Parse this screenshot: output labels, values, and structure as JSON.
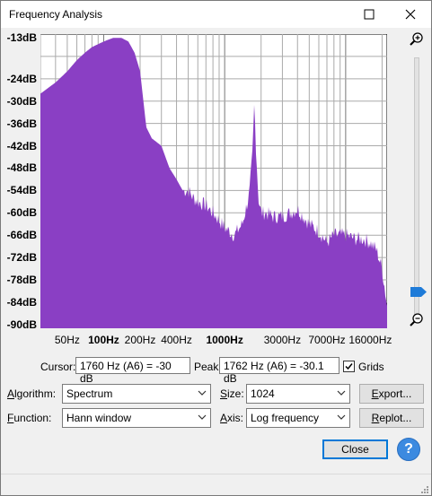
{
  "window": {
    "title": "Frequency Analysis"
  },
  "colors": {
    "spectrum_fill": "#8a3fc4",
    "grid": "#999999",
    "help": "#3c8ae0",
    "slider_thumb": "#1e7bd8"
  },
  "chart_data": {
    "type": "area",
    "title": "",
    "xlabel": "",
    "ylabel": "",
    "x_scale": "log",
    "ylim": [
      -91,
      -12
    ],
    "grid": true,
    "y_ticks": [
      "-13dB",
      "-24dB",
      "-30dB",
      "-36dB",
      "-42dB",
      "-48dB",
      "-54dB",
      "-60dB",
      "-66dB",
      "-72dB",
      "-78dB",
      "-84dB",
      "-90dB"
    ],
    "x_ticks": [
      {
        "label": "50Hz",
        "bold": false
      },
      {
        "label": "100Hz",
        "bold": true
      },
      {
        "label": "200Hz",
        "bold": false
      },
      {
        "label": "400Hz",
        "bold": false
      },
      {
        "label": "1000Hz",
        "bold": true
      },
      {
        "label": "3000Hz",
        "bold": false
      },
      {
        "label": "7000Hz",
        "bold": false
      },
      {
        "label": "16000Hz",
        "bold": false
      }
    ],
    "series": [
      {
        "x": [
          30,
          40,
          50,
          60,
          70,
          80,
          100,
          120,
          140,
          160,
          180,
          200,
          225,
          250,
          300,
          350,
          400,
          450,
          500,
          550,
          600,
          700,
          800,
          900,
          1000,
          1200,
          1400,
          1600,
          1700,
          1760,
          1800,
          1900,
          2000,
          2200,
          2500,
          3000,
          3500,
          4000,
          5000,
          6000,
          7000,
          8000,
          10000,
          12000,
          14000,
          16000,
          18000,
          20000,
          22000
        ],
        "y": [
          -28,
          -25,
          -22,
          -19,
          -17,
          -15.5,
          -14,
          -13,
          -13,
          -14,
          -17,
          -22,
          -37,
          -40,
          -42,
          -48,
          -51,
          -54,
          -54,
          -56,
          -57,
          -58,
          -60,
          -62,
          -64,
          -66,
          -63,
          -55,
          -44,
          -30,
          -40,
          -56,
          -60,
          -60,
          -61,
          -61,
          -60,
          -59,
          -63,
          -65,
          -68,
          -66,
          -66,
          -67,
          -67,
          -68,
          -70,
          -75,
          -85
        ]
      }
    ]
  },
  "controls": {
    "cursor_label": "Cursor:",
    "cursor_value": "1760 Hz (A6) = -30 dB",
    "peak_label": "Peak:",
    "peak_value": "1762 Hz (A6) = -30.1 dB",
    "grids_label": "Grids",
    "grids_checked": true,
    "algorithm_label": "Algorithm:",
    "algorithm_value": "Spectrum",
    "size_label": "Size:",
    "size_value": "1024",
    "function_label": "Function:",
    "function_value": "Hann window",
    "axis_label": "Axis:",
    "axis_value": "Log frequency",
    "export_label": "Export...",
    "replot_label": "Replot...",
    "close_label": "Close",
    "help_label": "?"
  },
  "zoom": {
    "level": 0.08
  }
}
